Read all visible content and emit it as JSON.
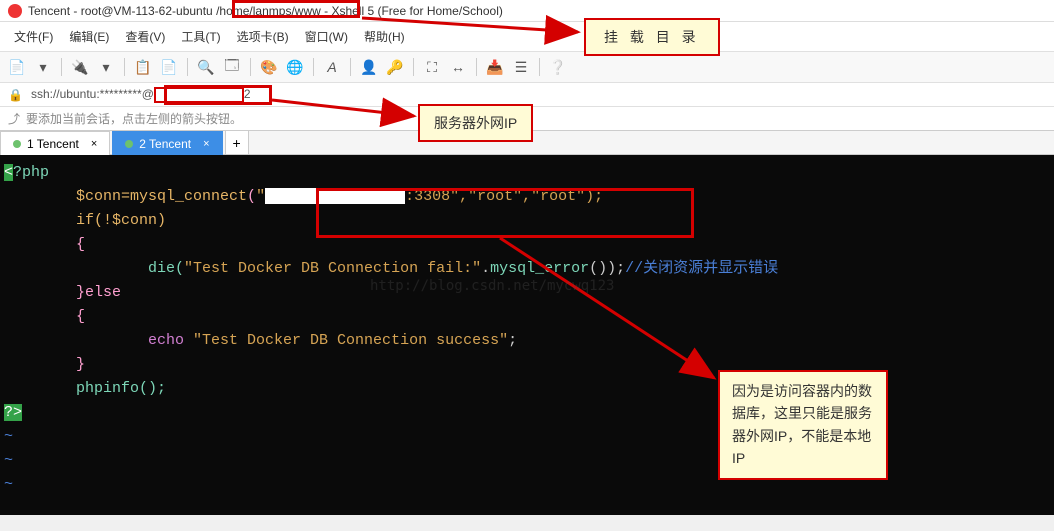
{
  "title": {
    "prefix": "Tencent - root@VM-113-62-ubuntu",
    "path": "/home/lanmps/www",
    "suffix": "- Xshell 5 (Free for Home/School)"
  },
  "menu": {
    "file": "文件(F)",
    "edit": "编辑(E)",
    "view": "查看(V)",
    "tools": "工具(T)",
    "tab": "选项卡(B)",
    "window": "窗口(W)",
    "help": "帮助(H)"
  },
  "addrbar": {
    "prefix": "ssh://ubuntu:*********@",
    "suffix": "2"
  },
  "hint": "要添加当前会话，点击左侧的箭头按钮。",
  "tabs": {
    "t1": "1 Tencent",
    "t2": "2 Tencent",
    "plus": "+"
  },
  "code": {
    "l0": "?php",
    "l1_pre": "        $conn=mysql_connect",
    "l1_q1": "\"",
    "l1_port": ":3308\"",
    "l1_rest": ",\"root\",\"root\");",
    "l2": "        if(!$conn)",
    "l3": "        {",
    "l4_pre": "                die(",
    "l4_str": "\"Test Docker DB Connection fail:\"",
    "l4_mid": ".",
    "l4_func": "mysql_error",
    "l4_end": "());",
    "l4_comment": "//关闭资源并显示错误",
    "l5": "        }else",
    "l6": "        {",
    "l7_pre": "                echo ",
    "l7_str": "\"Test Docker DB Connection success\"",
    "l7_end": ";",
    "l8": "        }",
    "l9": "",
    "l10": "        phpinfo();",
    "l11": "?>",
    "tilde": "~"
  },
  "callouts": {
    "c1": "挂 载 目 录",
    "c2": "服务器外网IP",
    "c3": "因为是访问容器内的数据库，这里只能是服务器外网IP，不能是本地IP"
  },
  "watermark": "http://blog.csdn.net/mycwq123"
}
